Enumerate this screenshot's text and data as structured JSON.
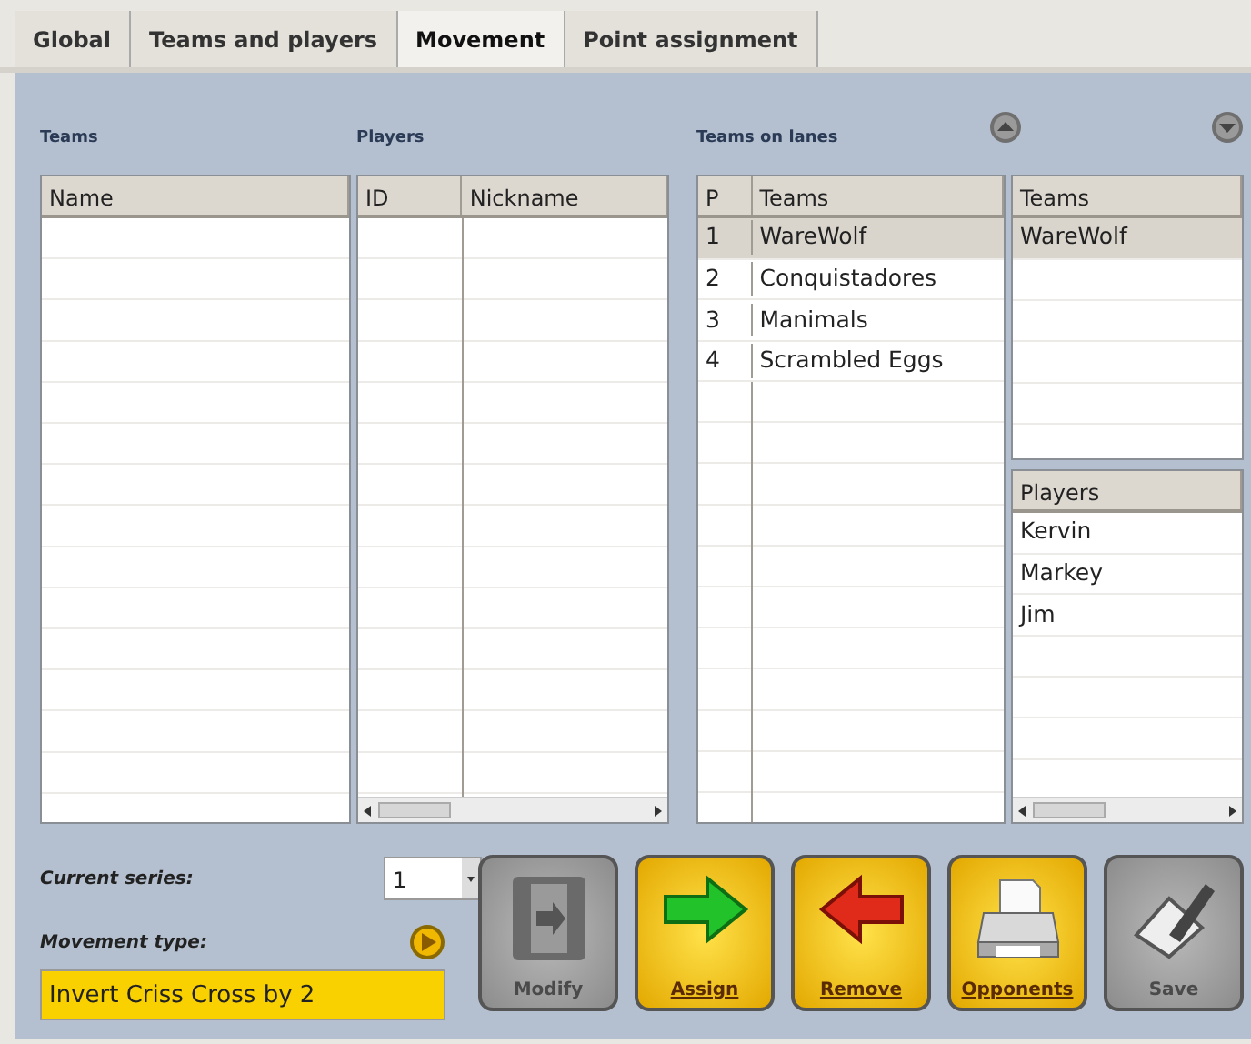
{
  "tabs": [
    {
      "label": "Global",
      "selected": false
    },
    {
      "label": "Teams and players",
      "selected": false
    },
    {
      "label": "Movement",
      "selected": true
    },
    {
      "label": "Point assignment",
      "selected": false
    }
  ],
  "teams_panel": {
    "label": "Teams",
    "columns": [
      "Name"
    ]
  },
  "players_panel": {
    "label": "Players",
    "columns": [
      "ID",
      "Nickname"
    ]
  },
  "lanes_panel": {
    "label": "Teams on lanes",
    "columns": [
      "P",
      "Teams"
    ],
    "rows": [
      {
        "cells": [
          "1",
          "WareWolf"
        ],
        "selected": true
      },
      {
        "cells": [
          "2",
          "Conquistadores"
        ],
        "selected": false
      },
      {
        "cells": [
          "3",
          "Manimals"
        ],
        "selected": false
      },
      {
        "cells": [
          "4",
          "Scrambled Eggs"
        ],
        "selected": false
      }
    ]
  },
  "lane_teams": {
    "columns": [
      "Teams"
    ],
    "rows": [
      {
        "text": "WareWolf",
        "selected": true
      }
    ]
  },
  "lane_players": {
    "columns": [
      "Players"
    ],
    "rows": [
      "Kervin",
      "Markey",
      "Jim"
    ]
  },
  "current_series": {
    "label": "Current series:",
    "value": "1"
  },
  "movement_type": {
    "label": "Movement type:",
    "value": "Invert Criss Cross by 2"
  },
  "buttons": [
    {
      "label": "Modify",
      "kind": "modify",
      "disabled": true
    },
    {
      "label": "Assign",
      "kind": "assign",
      "disabled": false
    },
    {
      "label": "Remove",
      "kind": "remove",
      "disabled": false
    },
    {
      "label": "Opponents",
      "kind": "opponents",
      "disabled": false
    },
    {
      "label": "Save",
      "kind": "save",
      "disabled": true
    }
  ]
}
